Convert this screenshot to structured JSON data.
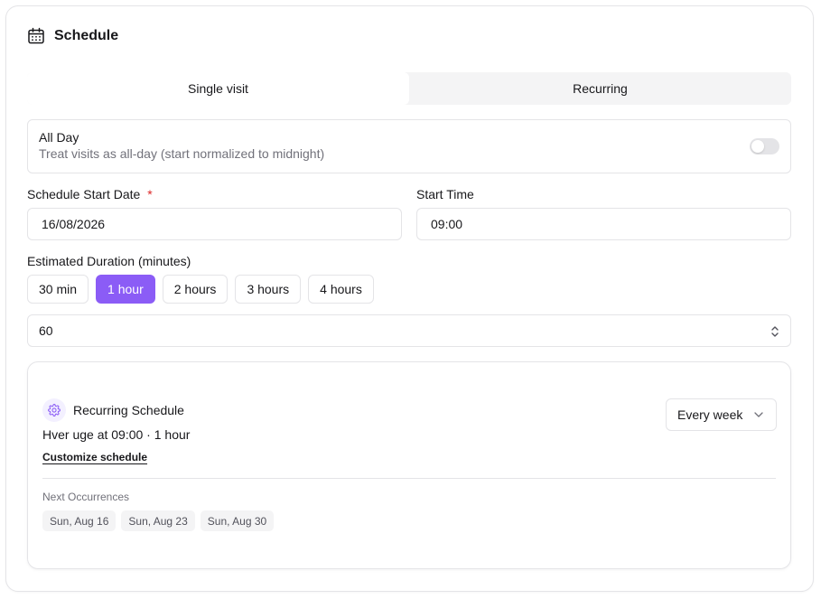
{
  "header": {
    "title": "Schedule",
    "icon": "calendar-icon"
  },
  "tabs": [
    {
      "label": "Single visit",
      "active": true
    },
    {
      "label": "Recurring",
      "active": false
    }
  ],
  "all_day": {
    "title": "All Day",
    "description": "Treat visits as all-day (start normalized to midnight)",
    "enabled": false
  },
  "start_date": {
    "label": "Schedule Start Date",
    "required_mark": "*",
    "value": "16/08/2026"
  },
  "start_time": {
    "label": "Start Time",
    "value": "09:00"
  },
  "duration": {
    "label": "Estimated Duration (minutes)",
    "presets": [
      "30 min",
      "1 hour",
      "2 hours",
      "3 hours",
      "4 hours"
    ],
    "selected": "1 hour",
    "value": "60"
  },
  "recurring": {
    "title": "Recurring Schedule",
    "summary": "Hver uge at 09:00 · 1 hour",
    "customize_label": "Customize schedule",
    "frequency": "Every week",
    "next_label": "Next Occurrences",
    "occurrences": [
      "Sun, Aug 16",
      "Sun, Aug 23",
      "Sun, Aug 30"
    ]
  },
  "colors": {
    "accent": "#8b5cf6",
    "border": "#e4e4e7",
    "muted_text": "#71717a",
    "required": "#dc2626"
  }
}
